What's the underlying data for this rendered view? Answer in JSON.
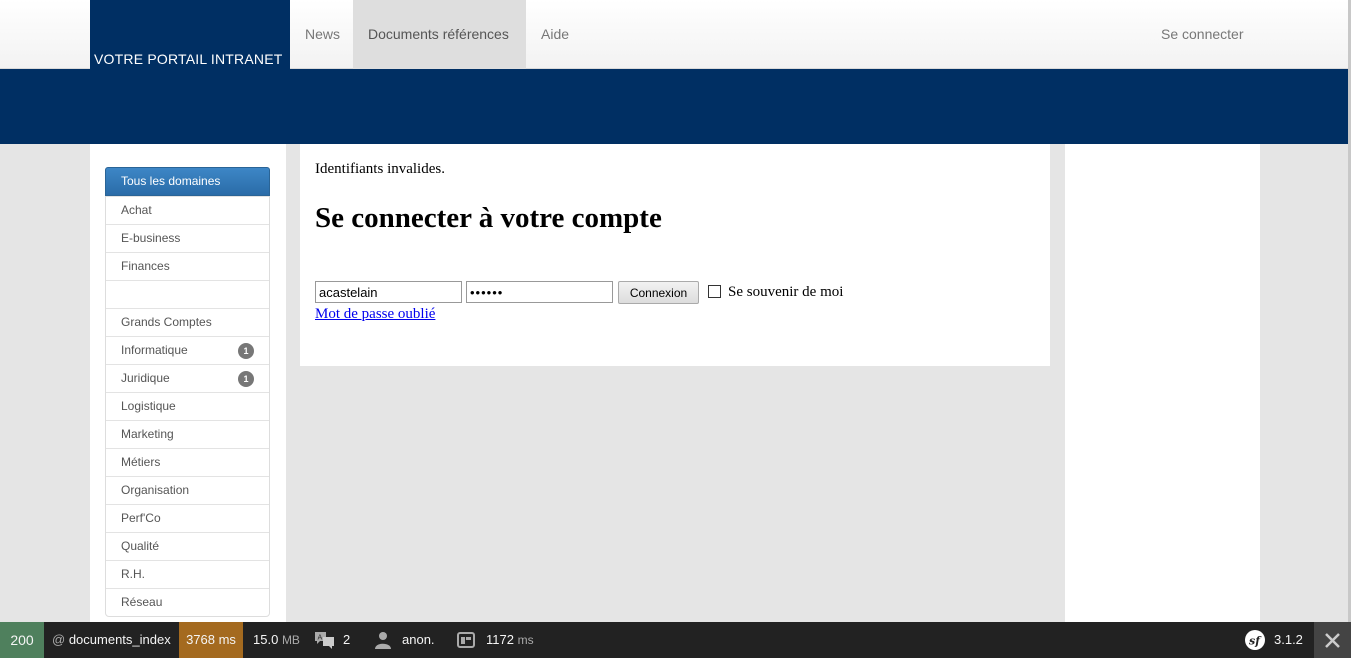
{
  "header": {
    "brand": "VOTRE PORTAIL INTRANET",
    "nav": [
      {
        "label": "News",
        "active": false
      },
      {
        "label": "Documents références",
        "active": true
      },
      {
        "label": "Aide",
        "active": false
      }
    ],
    "login_link": "Se connecter"
  },
  "colors": {
    "brand_blue": "#002f63",
    "active_domain": "#2a6ca8",
    "toolbar_status": "#4f805d",
    "toolbar_time": "#a46a1f"
  },
  "sidebar": {
    "items": [
      {
        "label": "Tous les domaines",
        "active": true
      },
      {
        "label": "Achat"
      },
      {
        "label": "E-business"
      },
      {
        "label": "Finances"
      },
      {
        "label": ""
      },
      {
        "label": "Grands Comptes"
      },
      {
        "label": "Informatique",
        "badge": "1"
      },
      {
        "label": "Juridique",
        "badge": "1"
      },
      {
        "label": "Logistique"
      },
      {
        "label": "Marketing"
      },
      {
        "label": "Métiers"
      },
      {
        "label": "Organisation"
      },
      {
        "label": "Perf'Co"
      },
      {
        "label": "Qualité"
      },
      {
        "label": "R.H."
      },
      {
        "label": "Réseau"
      }
    ]
  },
  "main": {
    "error": "Identifiants invalides.",
    "title": "Se connecter à votre compte",
    "username_value": "acastelain",
    "password_value": "••••••",
    "submit_label": "Connexion",
    "remember_label": "Se souvenir de moi",
    "remember_checked": false,
    "forgot_link": "Mot de passe oublié"
  },
  "debug_toolbar": {
    "status": "200",
    "route_prefix": "@",
    "route": "documents_index",
    "time": "3768 ms",
    "memory_value": "15.0",
    "memory_unit": "MB",
    "translations": "2",
    "user": "anon.",
    "timer_value": "1172",
    "timer_unit": "ms",
    "version": "3.1.2",
    "icons": [
      "translation-icon",
      "user-icon",
      "timeline-icon",
      "symfony-logo-icon",
      "close-icon"
    ]
  }
}
